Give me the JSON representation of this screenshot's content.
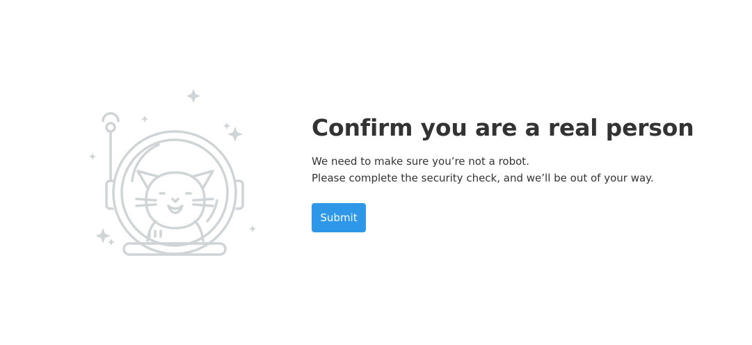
{
  "colors": {
    "illustration": "#cfd4d7",
    "title": "#333333",
    "button": "#2f97e8",
    "button_text": "#ffffff"
  },
  "illustration": {
    "icon": "astronaut-cat-icon"
  },
  "main": {
    "title": "Confirm you are a real person",
    "line1": "We need to make sure you’re not a robot.",
    "line2": "Please complete the security check, and we’ll be out of your way.",
    "submit_label": "Submit"
  }
}
